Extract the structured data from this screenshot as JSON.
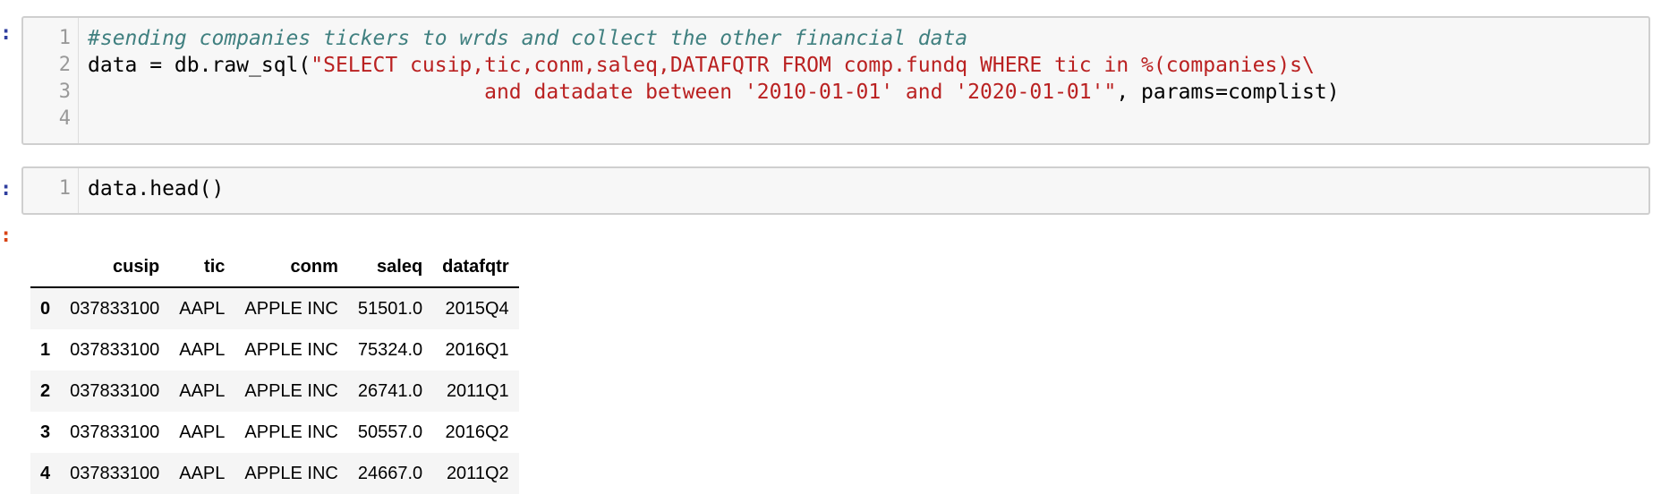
{
  "cells": {
    "cell1": {
      "prompt": ":",
      "line_numbers": [
        "1",
        "2",
        "3",
        "4"
      ],
      "lines": [
        [
          {
            "text": "#sending companies tickers to wrds and collect the other financial data",
            "kind": "comment"
          }
        ],
        [
          {
            "text": "data = db.raw_sql(",
            "kind": "plain"
          },
          {
            "text": "\"SELECT cusip,tic,conm,saleq,DATAFQTR FROM comp.fundq WHERE tic in %(companies)s\\",
            "kind": "string"
          }
        ],
        [
          {
            "text": "                                ",
            "kind": "plain"
          },
          {
            "text": "and datadate between '2010-01-01' and '2020-01-01'\"",
            "kind": "string"
          },
          {
            "text": ", params=complist)",
            "kind": "plain"
          }
        ],
        []
      ]
    },
    "cell2": {
      "prompt": ":",
      "line_numbers": [
        "1"
      ],
      "lines": [
        [
          {
            "text": "data.head()",
            "kind": "plain"
          }
        ]
      ]
    },
    "output_prompt": ":"
  },
  "dataframe": {
    "columns": [
      "",
      "cusip",
      "tic",
      "conm",
      "saleq",
      "datafqtr"
    ],
    "rows": [
      {
        "index": "0",
        "cusip": "037833100",
        "tic": "AAPL",
        "conm": "APPLE INC",
        "saleq": "51501.0",
        "datafqtr": "2015Q4"
      },
      {
        "index": "1",
        "cusip": "037833100",
        "tic": "AAPL",
        "conm": "APPLE INC",
        "saleq": "75324.0",
        "datafqtr": "2016Q1"
      },
      {
        "index": "2",
        "cusip": "037833100",
        "tic": "AAPL",
        "conm": "APPLE INC",
        "saleq": "26741.0",
        "datafqtr": "2011Q1"
      },
      {
        "index": "3",
        "cusip": "037833100",
        "tic": "AAPL",
        "conm": "APPLE INC",
        "saleq": "50557.0",
        "datafqtr": "2016Q2"
      },
      {
        "index": "4",
        "cusip": "037833100",
        "tic": "AAPL",
        "conm": "APPLE INC",
        "saleq": "24667.0",
        "datafqtr": "2011Q2"
      }
    ]
  }
}
